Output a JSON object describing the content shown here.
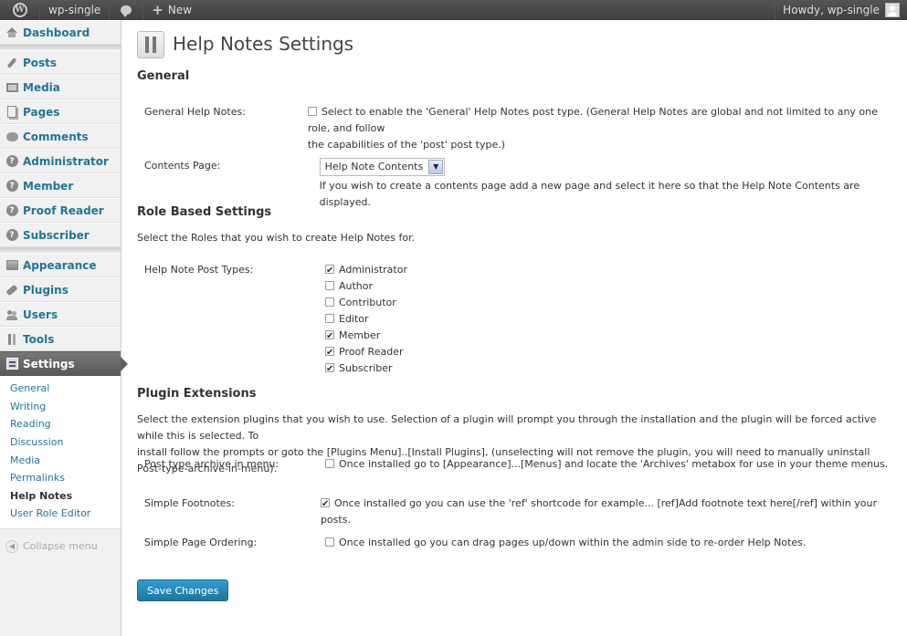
{
  "adminbar": {
    "site_name": "wp-single",
    "new_label": "New",
    "howdy": "Howdy, wp-single"
  },
  "sidebar": {
    "items": [
      {
        "label": "Dashboard",
        "icon": "dashboard-icon"
      },
      {
        "label": "Posts",
        "icon": "pin-icon"
      },
      {
        "label": "Media",
        "icon": "media-icon"
      },
      {
        "label": "Pages",
        "icon": "pages-icon"
      },
      {
        "label": "Comments",
        "icon": "comments-icon"
      },
      {
        "label": "Administrator",
        "icon": "help-icon"
      },
      {
        "label": "Member",
        "icon": "help-icon"
      },
      {
        "label": "Proof Reader",
        "icon": "help-icon"
      },
      {
        "label": "Subscriber",
        "icon": "help-icon"
      },
      {
        "label": "Appearance",
        "icon": "appearance-icon"
      },
      {
        "label": "Plugins",
        "icon": "plugin-icon"
      },
      {
        "label": "Users",
        "icon": "users-icon"
      },
      {
        "label": "Tools",
        "icon": "tools-icon"
      },
      {
        "label": "Settings",
        "icon": "settings-icon"
      }
    ],
    "submenu": [
      "General",
      "Writing",
      "Reading",
      "Discussion",
      "Media",
      "Permalinks",
      "Help Notes",
      "User Role Editor"
    ],
    "collapse": "Collapse menu"
  },
  "page": {
    "title": "Help Notes Settings",
    "general": {
      "heading": "General",
      "help_notes_label": "General Help Notes:",
      "help_notes_desc_1": "Select to enable the 'General' Help Notes post type. (General Help Notes are global and not limited to any one role, and follow",
      "help_notes_desc_2": "the capabilities of the 'post' post type.)",
      "contents_label": "Contents Page:",
      "contents_value": "Help Note Contents",
      "contents_desc": "If you wish to create a contents page add a new page and select it here so that the Help Note Contents are displayed."
    },
    "roles": {
      "heading": "Role Based Settings",
      "intro": "Select the Roles that you wish to create Help Notes for.",
      "label": "Help Note Post Types:",
      "options": [
        {
          "label": "Administrator",
          "checked": true
        },
        {
          "label": "Author",
          "checked": false
        },
        {
          "label": "Contributor",
          "checked": false
        },
        {
          "label": "Editor",
          "checked": false
        },
        {
          "label": "Member",
          "checked": true
        },
        {
          "label": "Proof Reader",
          "checked": true
        },
        {
          "label": "Subscriber",
          "checked": true
        }
      ]
    },
    "extensions": {
      "heading": "Plugin Extensions",
      "intro_1": "Select the extension plugins that you wish to use. Selection of a plugin will prompt you through the installation and the plugin will be forced active while this is selected. To",
      "intro_2": "install follow the prompts or goto the [Plugins Menu]..[Install Plugins], (unselecting will not remove the plugin, you will need to manually uninstall Post-type-archive-in-menu).",
      "rows": [
        {
          "label": "Post type archive in menu:",
          "desc": "Once installed go to [Appearance]...[Menus] and locate the 'Archives' metabox for use in your theme menus.",
          "checked": false
        },
        {
          "label": "Simple Footnotes:",
          "desc": "Once installed go you can use the 'ref' shortcode for example... [ref]Add footnote text here[/ref] within your posts.",
          "checked": true
        },
        {
          "label": "Simple Page Ordering:",
          "desc": "Once installed go you can drag pages up/down within the admin side to re-order Help Notes.",
          "checked": false
        }
      ]
    },
    "save_label": "Save Changes"
  }
}
